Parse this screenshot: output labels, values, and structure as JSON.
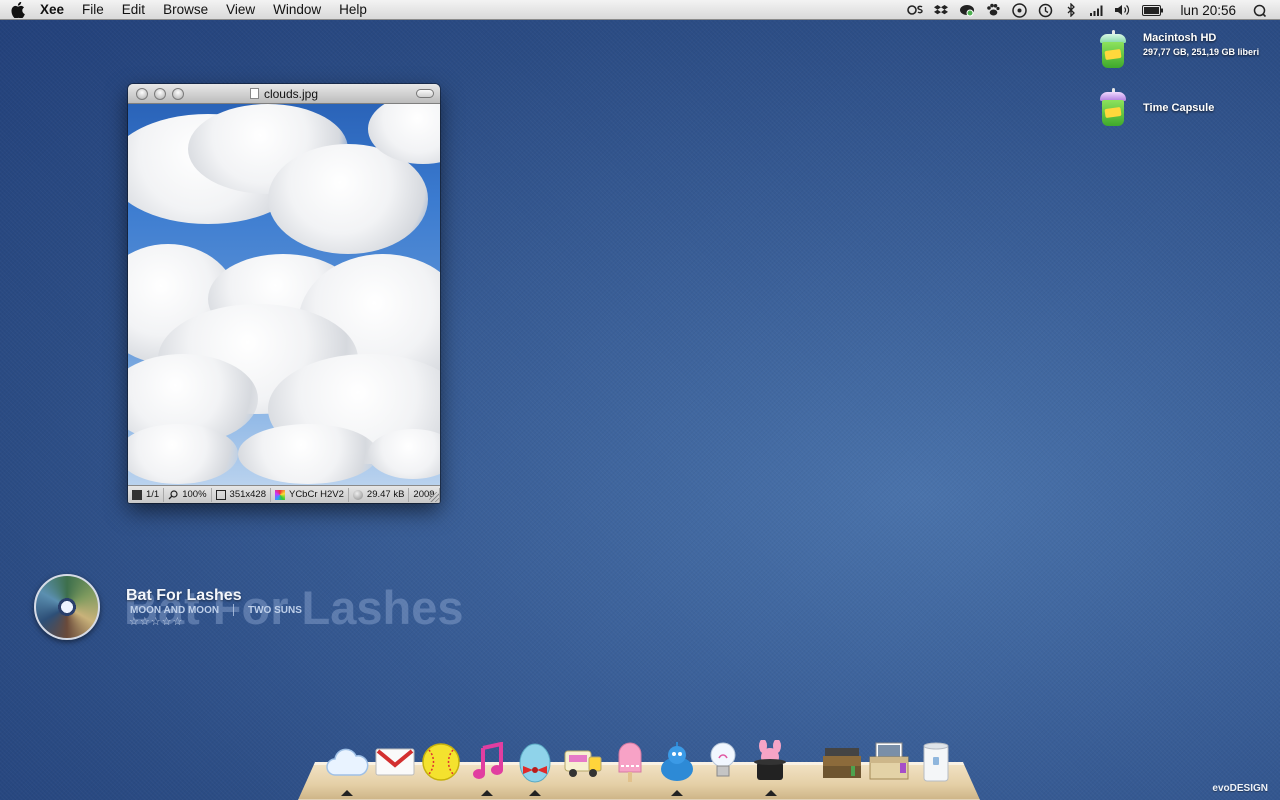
{
  "menubar": {
    "app_name": "Xee",
    "menus": [
      "File",
      "Edit",
      "Browse",
      "View",
      "Window",
      "Help"
    ],
    "clock": "lun 20:56"
  },
  "desktop": {
    "drives": [
      {
        "name": "Macintosh HD",
        "info": "297,77 GB, 251,19 GB liberi"
      },
      {
        "name": "Time Capsule",
        "info": ""
      }
    ]
  },
  "xee_window": {
    "title": "clouds.jpg",
    "status": {
      "page": "1/1",
      "zoom": "100%",
      "dimensions": "351x428",
      "color_mode": "YCbCr H2V2",
      "file_size": "29.47 kB",
      "date": "2009"
    }
  },
  "now_playing": {
    "ghost_title": "Bat For Lashes",
    "artist": "Bat For Lashes",
    "album": "MOON AND MOON",
    "track": "TWO SUNS",
    "stars": "☆☆☆☆☆"
  },
  "dock": {
    "items": [
      {
        "icon": "cloud-icon",
        "running": true
      },
      {
        "icon": "gmail-icon",
        "running": false
      },
      {
        "icon": "softball-icon",
        "running": true
      },
      {
        "icon": "music-note-icon",
        "running": true
      },
      {
        "icon": "egg-bowtie-icon",
        "running": true
      },
      {
        "icon": "truck-icon",
        "running": false
      },
      {
        "icon": "popsicle-icon",
        "running": false
      },
      {
        "icon": "blue-creature-icon",
        "running": true
      },
      {
        "icon": "lightbulb-icon",
        "running": false
      },
      {
        "icon": "magic-hat-icon",
        "running": true
      },
      {
        "icon": "book-stack-icon",
        "running": false
      },
      {
        "icon": "photo-box-icon",
        "running": false
      },
      {
        "icon": "trash-can-icon",
        "running": false
      }
    ]
  },
  "watermark": "evoDESIGN"
}
